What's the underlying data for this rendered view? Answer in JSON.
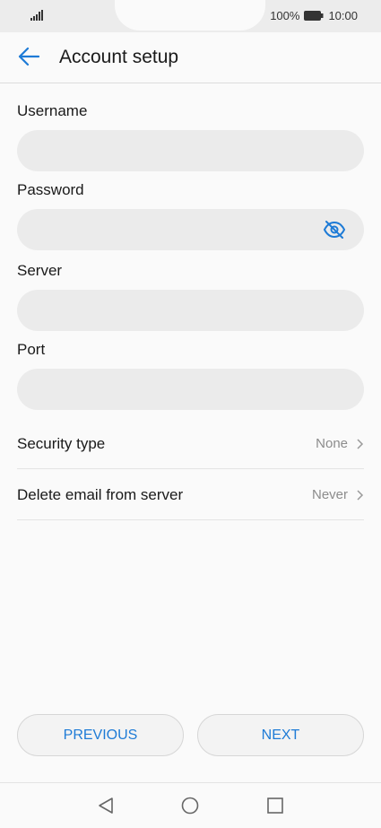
{
  "status_bar": {
    "battery_percent": "100%",
    "time": "10:00",
    "icons": [
      "signal-icon",
      "battery-icon"
    ]
  },
  "app_bar": {
    "title": "Account setup",
    "back_icon": "back-arrow-icon"
  },
  "form": {
    "username": {
      "label": "Username",
      "value": "",
      "placeholder": ""
    },
    "password": {
      "label": "Password",
      "value": "",
      "placeholder": "",
      "toggle_icon": "eye-off-icon"
    },
    "server": {
      "label": "Server",
      "value": "",
      "placeholder": ""
    },
    "port": {
      "label": "Port",
      "value": "",
      "placeholder": ""
    }
  },
  "settings": [
    {
      "label": "Security type",
      "value": "None"
    },
    {
      "label": "Delete email from server",
      "value": "Never"
    }
  ],
  "buttons": {
    "previous": "PREVIOUS",
    "next": "NEXT"
  },
  "nav_bar": {
    "icons": [
      "back-triangle-icon",
      "home-circle-icon",
      "recents-square-icon"
    ]
  },
  "colors": {
    "accent": "#1e7bd6",
    "field_bg": "#ebebeb",
    "secondary_text": "#8c8c8c"
  }
}
